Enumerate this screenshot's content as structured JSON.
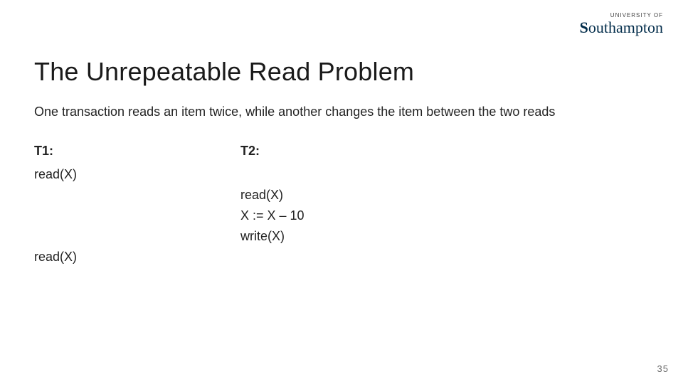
{
  "logo": {
    "top": "UNIVERSITY OF",
    "name": "Southampton"
  },
  "title": "The Unrepeatable Read Problem",
  "description_parts": [
    "One transaction reads an item twice, while another changes the item between the two",
    "reads"
  ],
  "columns": {
    "t1_header": "T1:",
    "t2_header": "T2:"
  },
  "rows": [
    {
      "t1": "read(X)",
      "t2": ""
    },
    {
      "t1": "",
      "t2": "read(X)"
    },
    {
      "t1": "",
      "t2": "X := X – 10"
    },
    {
      "t1": "",
      "t2": "write(X)"
    },
    {
      "t1": "read(X)",
      "t2": ""
    }
  ],
  "page_number": "35"
}
